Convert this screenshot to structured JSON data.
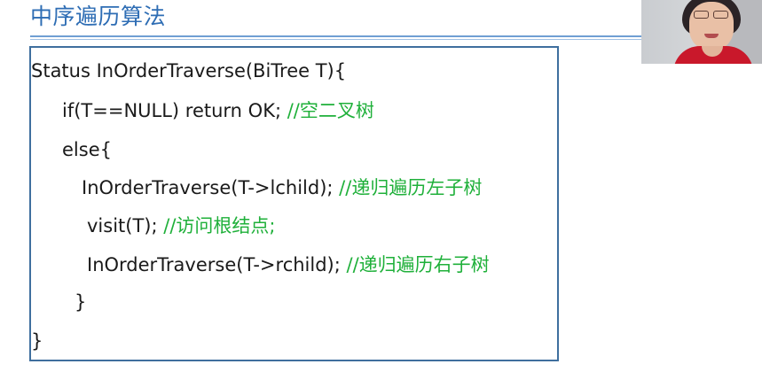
{
  "slide": {
    "title": "中序遍历算法"
  },
  "code": {
    "lines": [
      {
        "text": "Status InOrderTraverse(BiTree T){",
        "comment": ""
      },
      {
        "text": "if(T==NULL) return OK; ",
        "comment": "//空二叉树"
      },
      {
        "text": "else{",
        "comment": ""
      },
      {
        "text": "InOrderTraverse(T->lchild); ",
        "comment": "//递归遍历左子树"
      },
      {
        "text": "visit(T);  ",
        "comment": "//访问根结点;"
      },
      {
        "text": "InOrderTraverse(T->rchild); ",
        "comment": "//递归遍历右子树"
      },
      {
        "text": "}",
        "comment": ""
      },
      {
        "text": "}",
        "comment": ""
      }
    ]
  },
  "colors": {
    "title": "#2e6db4",
    "rule": "#6f9fd3",
    "code_text": "#1a1a1a",
    "comment": "#1fb03a",
    "box_border": "#3f6f9e",
    "webcam_coat": "#c9182b"
  },
  "webcam": {
    "icon": "presenter-video-feed"
  }
}
